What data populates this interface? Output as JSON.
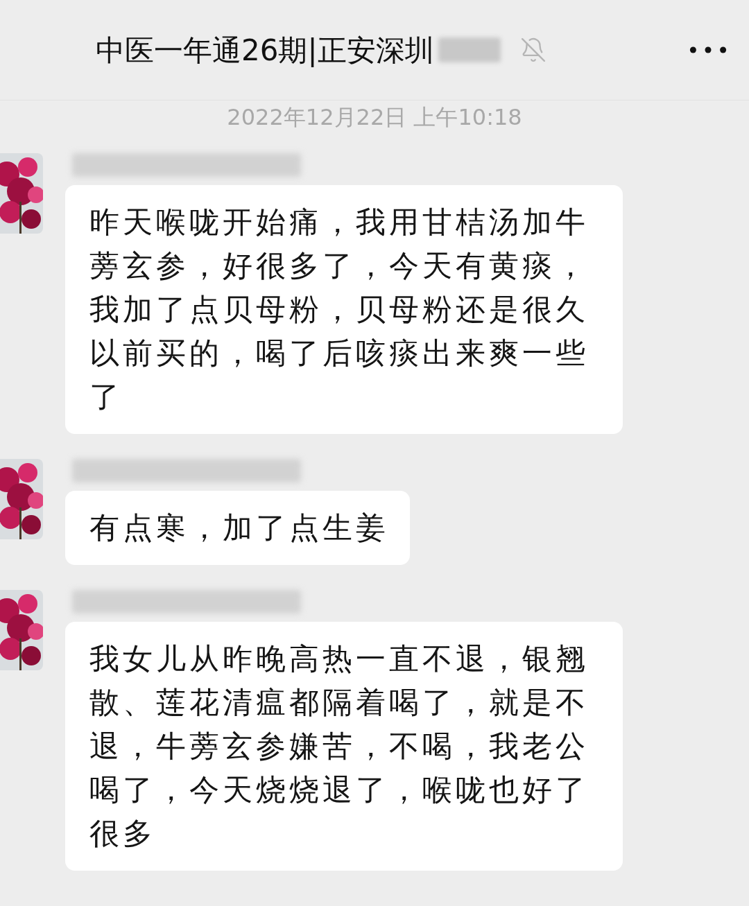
{
  "header": {
    "title": "中医一年通26期|正安深圳",
    "muted": true
  },
  "timestamp": "2022年12月22日 上午10:18",
  "messages": [
    {
      "text": "昨天喉咙开始痛，我用甘桔汤加牛蒡玄参，好很多了，今天有黄痰，我加了点贝母粉，贝母粉还是很久以前买的，喝了后咳痰出来爽一些了"
    },
    {
      "text": "有点寒，加了点生姜"
    },
    {
      "text": "我女儿从昨晚高热一直不退，银翘散、莲花清瘟都隔着喝了，就是不退，牛蒡玄参嫌苦，不喝，我老公喝了，今天烧烧退了，喉咙也好了很多"
    }
  ]
}
